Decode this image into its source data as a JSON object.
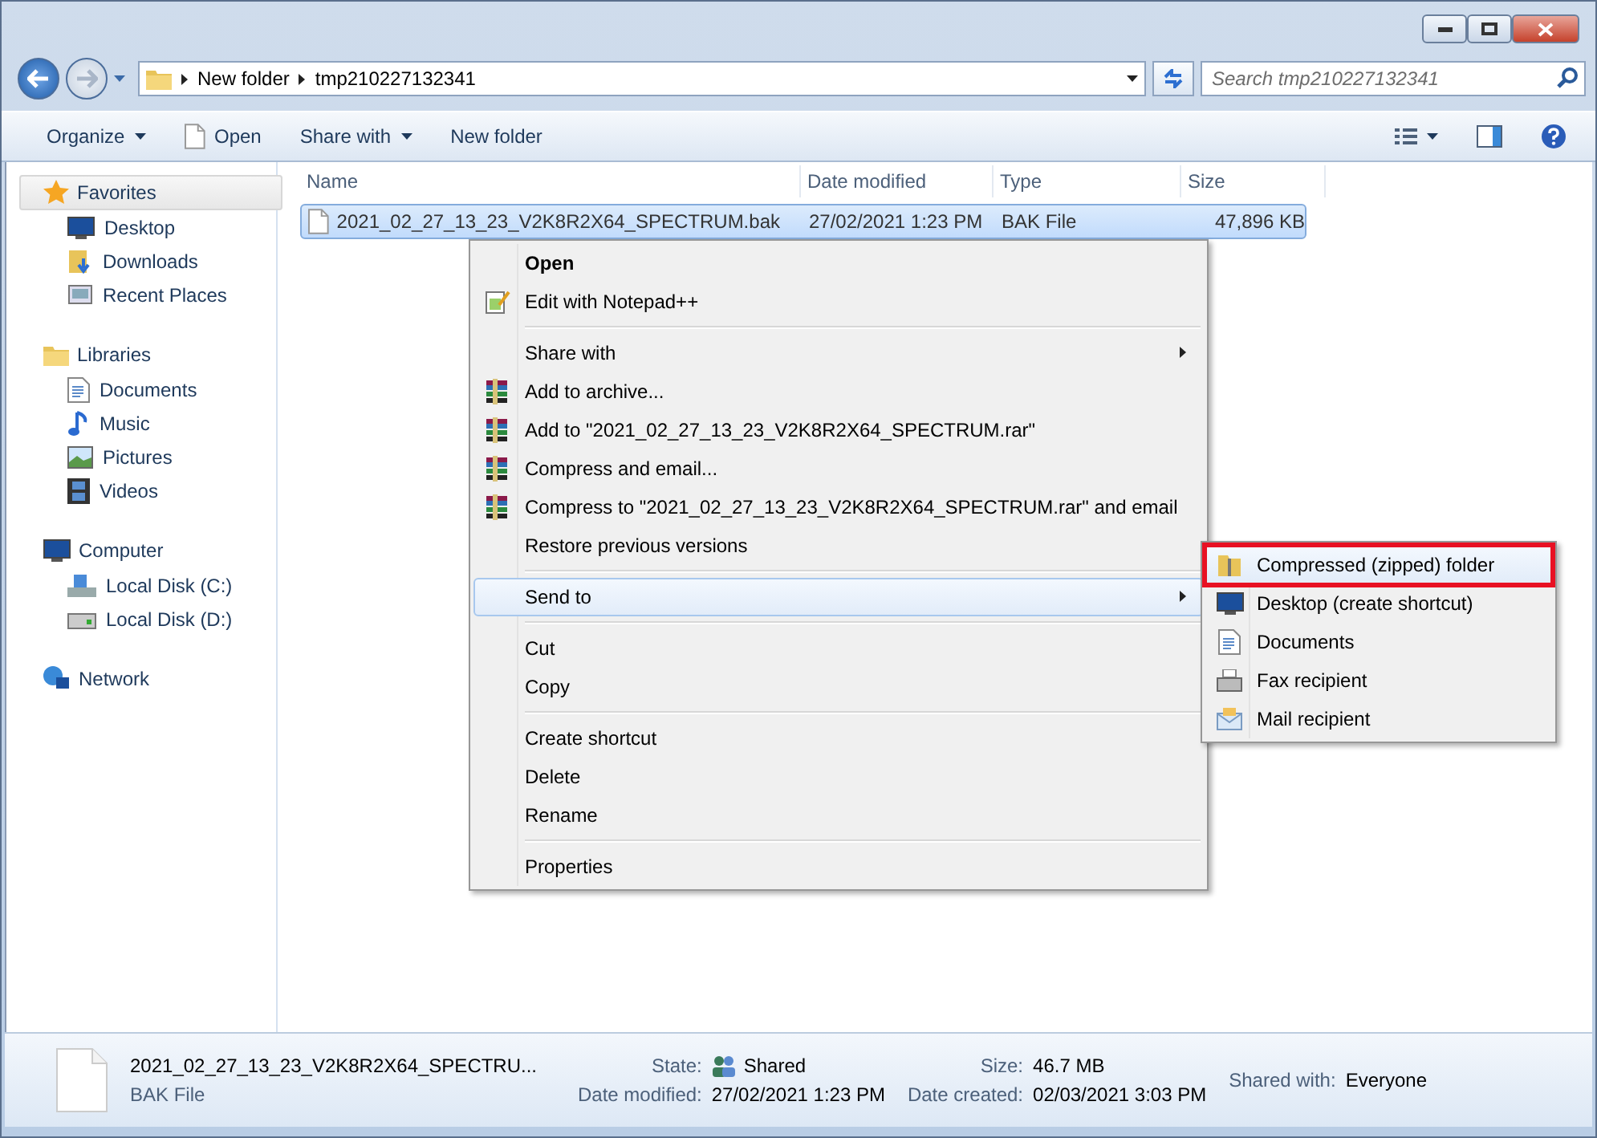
{
  "address": {
    "path": [
      "New folder",
      "tmp210227132341"
    ]
  },
  "search": {
    "placeholder": "Search tmp210227132341"
  },
  "toolbar": [
    {
      "label": "Organize",
      "dropdown": true
    },
    {
      "label": "Open",
      "dropdown": false
    },
    {
      "label": "Share with",
      "dropdown": true
    },
    {
      "label": "New folder",
      "dropdown": false
    }
  ],
  "sidebar": [
    {
      "label": "Favorites",
      "selected": true,
      "children": [
        {
          "label": "Desktop"
        },
        {
          "label": "Downloads"
        },
        {
          "label": "Recent Places"
        }
      ]
    },
    {
      "label": "Libraries",
      "selected": false,
      "children": [
        {
          "label": "Documents"
        },
        {
          "label": "Music"
        },
        {
          "label": "Pictures"
        },
        {
          "label": "Videos"
        }
      ]
    },
    {
      "label": "Computer",
      "selected": false,
      "children": [
        {
          "label": "Local Disk (C:)"
        },
        {
          "label": "Local Disk (D:)"
        }
      ]
    },
    {
      "label": "Network",
      "selected": false
    }
  ],
  "table": {
    "columns": [
      "Name",
      "Date modified",
      "Type",
      "Size"
    ],
    "rows": [
      {
        "selected": true,
        "cells": [
          "2021_02_27_13_23_V2K8R2X64_SPECTRUM.bak",
          "27/02/2021 1:23 PM",
          "BAK File",
          "47,896 KB"
        ]
      }
    ]
  },
  "context_menu": {
    "groups": [
      [
        {
          "label": "Open",
          "default": true,
          "submenu": false,
          "selected": false
        },
        {
          "label": "Edit with Notepad++",
          "default": false,
          "submenu": false,
          "selected": false
        }
      ],
      [
        {
          "label": "Share with",
          "default": false,
          "submenu": true,
          "selected": false
        },
        {
          "label": "Add to archive...",
          "default": false,
          "submenu": false,
          "selected": false
        },
        {
          "label": "Add to \"2021_02_27_13_23_V2K8R2X64_SPECTRUM.rar\"",
          "default": false,
          "submenu": false,
          "selected": false
        },
        {
          "label": "Compress and email...",
          "default": false,
          "submenu": false,
          "selected": false
        },
        {
          "label": "Compress to \"2021_02_27_13_23_V2K8R2X64_SPECTRUM.rar\" and email",
          "default": false,
          "submenu": false,
          "selected": false
        },
        {
          "label": "Restore previous versions",
          "default": false,
          "submenu": false,
          "selected": false
        }
      ],
      [
        {
          "label": "Send to",
          "default": false,
          "submenu": true,
          "selected": true
        }
      ],
      [
        {
          "label": "Cut",
          "default": false,
          "submenu": false,
          "selected": false
        },
        {
          "label": "Copy",
          "default": false,
          "submenu": false,
          "selected": false
        }
      ],
      [
        {
          "label": "Create shortcut",
          "default": false,
          "submenu": false,
          "selected": false
        },
        {
          "label": "Delete",
          "default": false,
          "submenu": false,
          "selected": false
        },
        {
          "label": "Rename",
          "default": false,
          "submenu": false,
          "selected": false
        }
      ],
      [
        {
          "label": "Properties",
          "default": false,
          "submenu": false,
          "selected": false
        }
      ]
    ]
  },
  "send_to_menu": [
    {
      "label": "Compressed (zipped) folder",
      "selected": true
    },
    {
      "label": "Desktop (create shortcut)",
      "selected": false
    },
    {
      "label": "Documents",
      "selected": false
    },
    {
      "label": "Fax recipient",
      "selected": false
    },
    {
      "label": "Mail recipient",
      "selected": false
    }
  ],
  "details": {
    "name": "2021_02_27_13_23_V2K8R2X64_SPECTRU...",
    "type": "BAK File",
    "columns": [
      [
        {
          "label": "State:",
          "value": "Shared",
          "kind": "shared"
        },
        {
          "label": "Date modified:",
          "value": "27/02/2021 1:23 PM",
          "kind": "plain"
        }
      ],
      [
        {
          "label": "Size:",
          "value": "46.7 MB",
          "kind": "plain"
        },
        {
          "label": "Date created:",
          "value": "02/03/2021 3:03 PM",
          "kind": "plain"
        }
      ],
      [
        {
          "label": "Shared with:",
          "value": "Everyone",
          "kind": "plain"
        }
      ]
    ]
  }
}
